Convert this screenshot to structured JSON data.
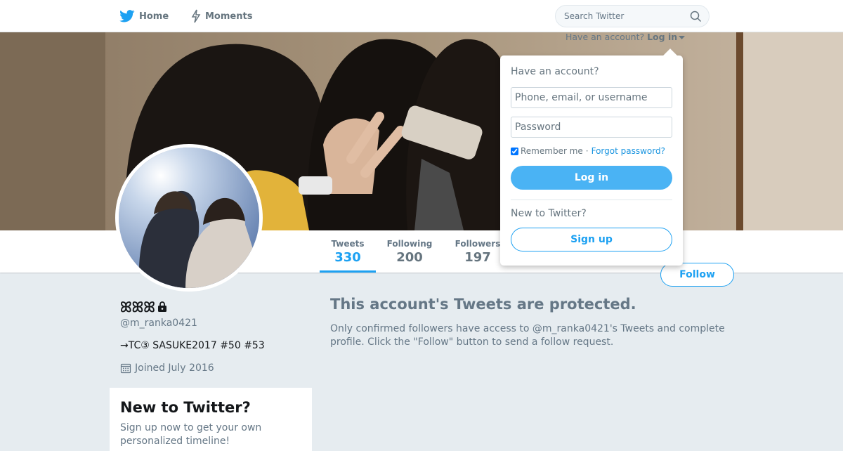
{
  "colors": {
    "accent": "#1da1f2",
    "background": "#e6ecf0",
    "muted": "#657786"
  },
  "topbar": {
    "home_label": "Home",
    "home_icon": "twitter-bird-icon",
    "moments_label": "Moments",
    "moments_icon": "lightning-icon",
    "search_placeholder": "Search Twitter",
    "search_icon": "search-icon"
  },
  "account_prompt": {
    "text": "Have an account?",
    "login_label": "Log in"
  },
  "login_dropdown": {
    "title": "Have an account?",
    "username_placeholder": "Phone, email, or username",
    "password_placeholder": "Password",
    "remember_label": "Remember me",
    "separator": "·",
    "forgot_label": "Forgot password?",
    "login_button": "Log in",
    "new_label": "New to Twitter?",
    "signup_button": "Sign up"
  },
  "stats": [
    {
      "label": "Tweets",
      "value": "330",
      "active": true
    },
    {
      "label": "Following",
      "value": "200",
      "active": false
    },
    {
      "label": "Followers",
      "value": "197",
      "active": false
    }
  ],
  "follow_button": "Follow",
  "profile": {
    "name": "ꕤꕤꕤ",
    "protected_icon": "lock-icon",
    "handle": "@m_ranka0421",
    "bio": "→TC③ SASUKE2017 #50 #53",
    "joined_icon": "calendar-icon",
    "joined": "Joined July 2016"
  },
  "protected": {
    "title": "This account's Tweets are protected.",
    "text": "Only confirmed followers have access to @m_ranka0421's Tweets and complete profile. Click the \"Follow\" button to send a follow request."
  },
  "signup_card": {
    "title": "New to Twitter?",
    "text": "Sign up now to get your own personalized timeline!"
  }
}
